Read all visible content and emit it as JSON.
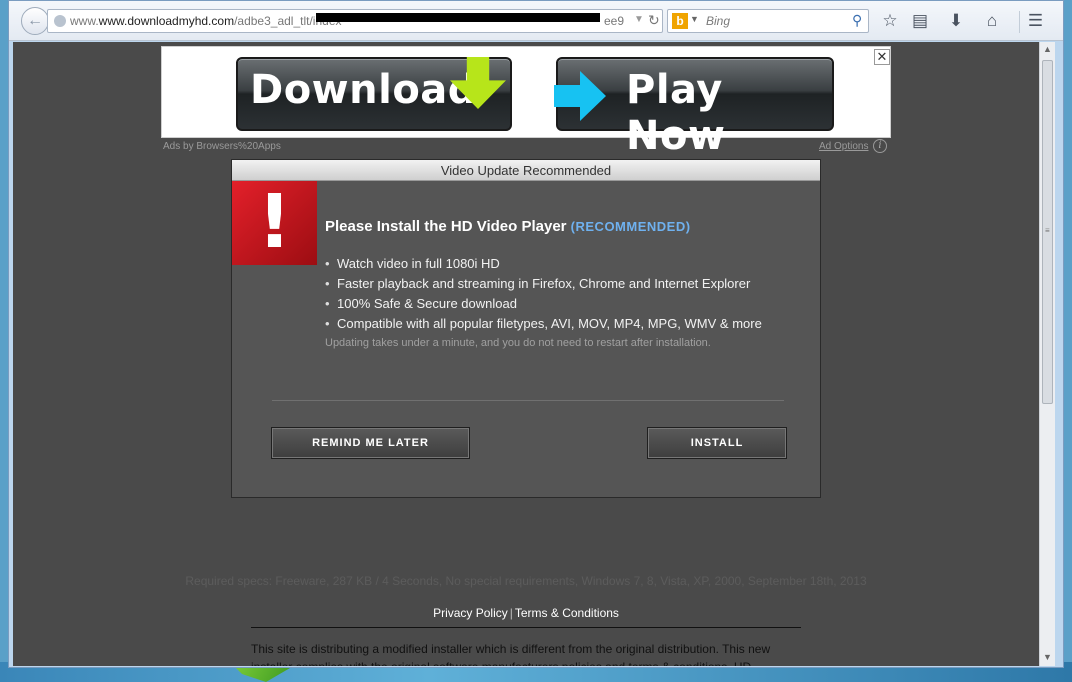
{
  "browser": {
    "url_domain": "www.downloadmyhd.com",
    "url_path": "/adbe3_adl_tlt/index",
    "url_prefix": "www.",
    "url_tail": "ee9",
    "search_engine": "Bing",
    "search_placeholder": "Bing"
  },
  "ad": {
    "download_label": "Download",
    "play_label": "Play Now",
    "attribution": "Ads by Browsers%20Apps",
    "options_label": "Ad Options",
    "close_glyph": "✕",
    "colors": {
      "download_arrow": "#b7e51a",
      "play_arrow": "#17c2f2"
    }
  },
  "dialog": {
    "title": "Video Update Recommended",
    "heading": "Please Install the HD Video Player",
    "heading_tag": "(RECOMMENDED)",
    "features": [
      "Watch video in full 1080i HD",
      "Faster playback and streaming in Firefox, Chrome and Internet Explorer",
      "100% Safe & Secure download",
      "Compatible with all popular filetypes, AVI, MOV, MP4, MPG, WMV & more"
    ],
    "note": "Updating takes under a minute, and you do not need to restart after installation.",
    "remind_label": "REMIND ME LATER",
    "install_label": "INSTALL",
    "alert_glyph": "!"
  },
  "footer": {
    "specs": "Required specs: Freeware, 287 KB / 4 Seconds, No special requirements, Windows 7, 8, Vista, XP, 2000, September 18th, 2013",
    "privacy_label": "Privacy Policy",
    "separator": "|",
    "terms_label": "Terms & Conditions",
    "disclaimer": "This site is distributing a modified installer which is different from the original distribution. This new installer complies with the original software manufacturers policies and terms & conditions. HD"
  },
  "icons": {
    "back": "back-arrow-icon",
    "bookmark": "star-icon",
    "bookmarks_list": "bookmarks-icon",
    "downloads": "download-icon",
    "home": "home-icon",
    "menu": "hamburger-menu-icon"
  }
}
